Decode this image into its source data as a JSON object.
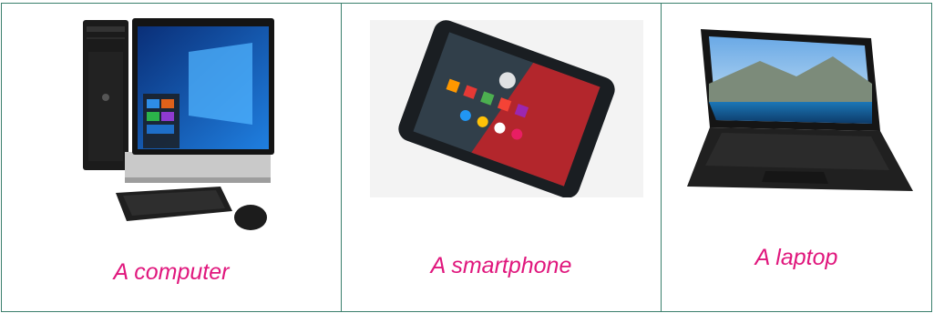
{
  "items": [
    {
      "caption": "A computer",
      "image_icon": "desktop-computer-icon"
    },
    {
      "caption": "A smartphone",
      "image_icon": "smartphone-icon"
    },
    {
      "caption": "A laptop",
      "image_icon": "laptop-icon"
    }
  ],
  "colors": {
    "border": "#3a7f6c",
    "caption": "#e0177d"
  }
}
